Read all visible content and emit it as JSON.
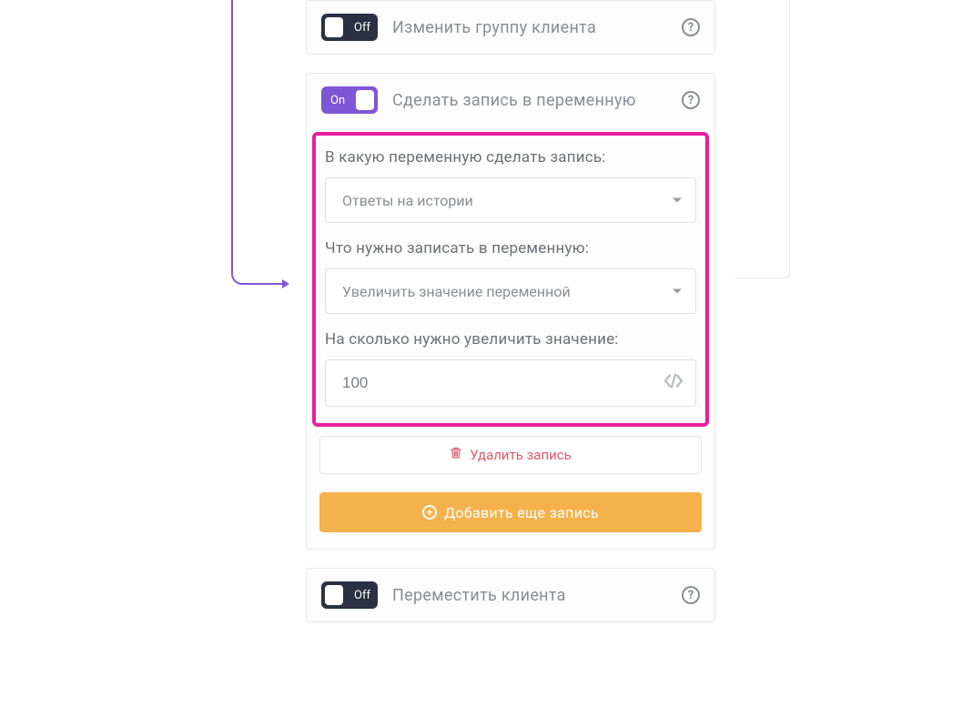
{
  "toggles": {
    "off": "Off",
    "on": "On"
  },
  "cards": {
    "change_group": {
      "title": "Изменить группу клиента"
    },
    "write_variable": {
      "title": "Сделать запись в переменную"
    },
    "move_client": {
      "title": "Переместить клиента"
    }
  },
  "form": {
    "which_variable_label": "В какую переменную сделать запись:",
    "which_variable_value": "Ответы на истории",
    "what_to_write_label": "Что нужно записать в переменную:",
    "what_to_write_value": "Увеличить значение переменной",
    "increase_by_label": "На сколько нужно увеличить значение:",
    "increase_by_value": "100"
  },
  "buttons": {
    "delete": "Удалить запись",
    "add_more": "Добавить еще запись"
  }
}
